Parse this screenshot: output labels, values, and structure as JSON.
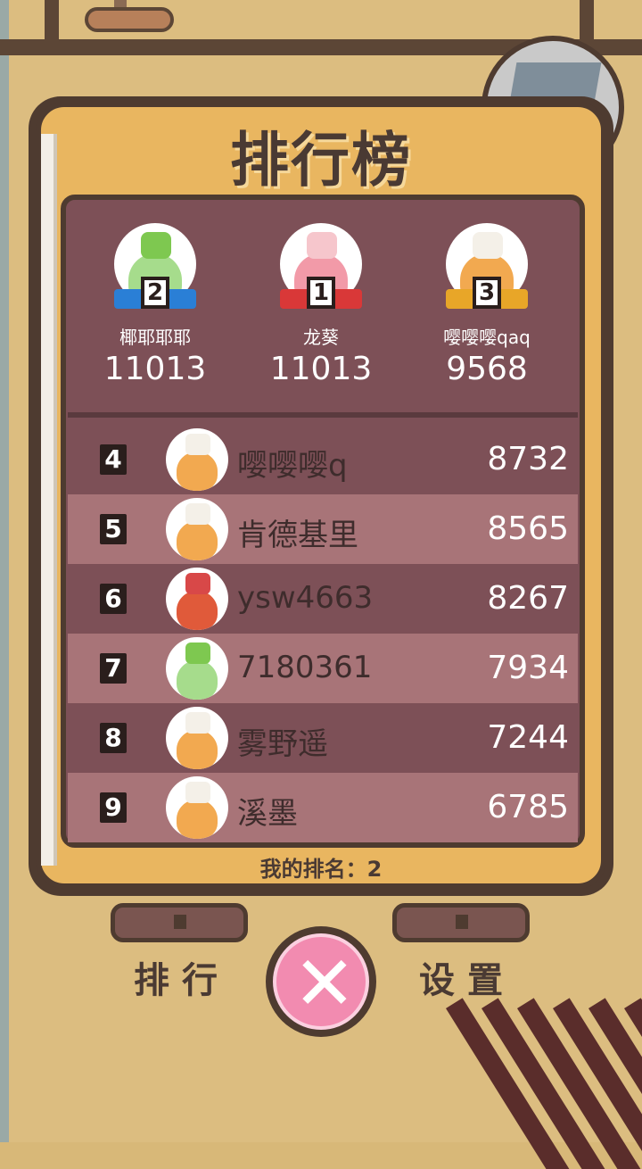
{
  "title": "排行榜",
  "top3": [
    {
      "rank": "2",
      "name": "椰耶耶耶",
      "score": "11013",
      "ribbon_color": "#2a7fd6",
      "body_color": "#a6dc8c",
      "hat_color": "#7ec850"
    },
    {
      "rank": "1",
      "name": "龙葵",
      "score": "11013",
      "ribbon_color": "#d93838",
      "body_color": "#f29aa8",
      "hat_color": "#f6c6cc"
    },
    {
      "rank": "3",
      "name": "嘤嘤嘤qaq",
      "score": "9568",
      "ribbon_color": "#e8a628",
      "body_color": "#f2a950",
      "hat_color": "#f4f0e8"
    }
  ],
  "list": [
    {
      "rank": "4",
      "name": "嘤嘤嘤q",
      "score": "8732",
      "body_color": "#f2a950",
      "hat_color": "#f4f0e8"
    },
    {
      "rank": "5",
      "name": "肯德基里",
      "score": "8565",
      "body_color": "#f2a950",
      "hat_color": "#f4f0e8"
    },
    {
      "rank": "6",
      "name": "ysw4663",
      "score": "8267",
      "body_color": "#e05a3a",
      "hat_color": "#d84848"
    },
    {
      "rank": "7",
      "name": "7180361",
      "score": "7934",
      "body_color": "#a6dc8c",
      "hat_color": "#7ec850"
    },
    {
      "rank": "8",
      "name": "雾野遥",
      "score": "7244",
      "body_color": "#f2a950",
      "hat_color": "#f4f0e8"
    },
    {
      "rank": "9",
      "name": "溪墨",
      "score": "6785",
      "body_color": "#f2a950",
      "hat_color": "#f4f0e8"
    }
  ],
  "my_rank_label": "我的排名：2",
  "nav": {
    "left_label": "排行",
    "right_label": "设置"
  },
  "close_icon": "close-icon"
}
